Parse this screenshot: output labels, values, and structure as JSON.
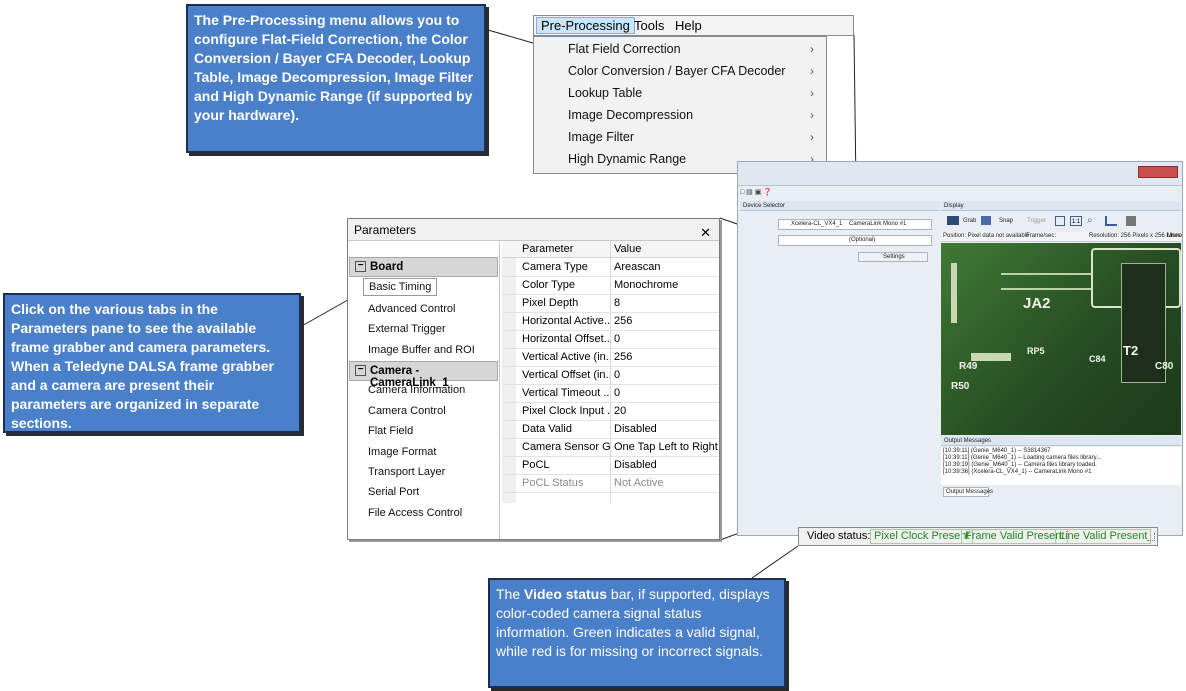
{
  "menu": {
    "bar": [
      "Pre-Processing",
      "Tools",
      "Help"
    ],
    "items": [
      "Flat Field Correction",
      "Color Conversion / Bayer CFA Decoder",
      "Lookup Table",
      "Image Decompression",
      "Image Filter",
      "High Dynamic Range"
    ]
  },
  "callouts": {
    "preprocessing": "The Pre-Processing menu allows you to configure Flat-Field Correction, the Color Conversion / Bayer CFA Decoder, Lookup Table, Image Decompression, Image Filter and High Dynamic Range (if supported by your hardware).",
    "parameters": "Click on the various tabs in the Parameters pane to see the available frame grabber and camera parameters. When a Teledyne DALSA frame grabber and a camera are present their parameters are organized in separate sections.",
    "video_bold": "Video status",
    "video_pre": "The ",
    "video_rest": " bar, if supported, displays color-coded camera signal status information. Green indicates a valid signal, while red is for missing or incorrect signals."
  },
  "app": {
    "device_selector": "Device Selector",
    "device_value": "Xcelera-CL_VX4_1",
    "config_value": "CameraLink Mono #1",
    "optional": "(Optional)",
    "settings": "Settings",
    "display": "Display",
    "toolbar": [
      "Grab",
      "Snap",
      "Trigger"
    ],
    "position_text": "Position: Pixel data not available",
    "frame_sec": "Frame/sec:",
    "resolution": "Resolution: 256 Pixels x 256 Lines",
    "mono": "Mono",
    "output_title": "Output Messages",
    "output_lines": [
      "[10:39:11] (Genie_M640_1) -- S3814367",
      "[10:39:11] (Genie_M640_1) -- Loading camera files library...",
      "[10:39:19] (Genie_M640_1) -- Camera files library loaded.",
      "[10:39:36] (Xcelera-CL_VX4_1) -- CameraLink Mono #1"
    ],
    "output_tab": "Output Messages",
    "pcb_labels": [
      "JA2",
      "R49",
      "RP5",
      "C84",
      "T2",
      "C80",
      "R50"
    ]
  },
  "parameters": {
    "title": "Parameters",
    "groups": [
      {
        "label": "Board",
        "items": [
          "Basic Timing",
          "Advanced Control",
          "External Trigger",
          "Image Buffer and ROI"
        ]
      },
      {
        "label": "Camera - CameraLink_1",
        "items": [
          "Camera Information",
          "Camera Control",
          "Flat Field",
          "Image Format",
          "Transport Layer",
          "Serial Port",
          "File Access Control"
        ]
      }
    ],
    "columns": [
      "Parameter",
      "Value"
    ],
    "rows": [
      [
        "Camera Type",
        "Areascan"
      ],
      [
        "Color Type",
        "Monochrome"
      ],
      [
        "Pixel Depth",
        "8"
      ],
      [
        "Horizontal Active...",
        "256"
      ],
      [
        "Horizontal Offset...",
        "0"
      ],
      [
        "Vertical Active (in...",
        "256"
      ],
      [
        "Vertical Offset (in...",
        "0"
      ],
      [
        "Vertical Timeout ...",
        "0"
      ],
      [
        "Pixel Clock Input ...",
        "20"
      ],
      [
        "Data Valid",
        "Disabled"
      ],
      [
        "Camera Sensor G...",
        "One Tap Left to Right"
      ],
      [
        "PoCL",
        "Disabled"
      ],
      [
        "PoCL Status",
        "Not Active"
      ]
    ]
  },
  "video_status": {
    "label": "Video status:",
    "items": [
      "Pixel Clock Present",
      "Frame Valid Present",
      "Line Valid Present"
    ]
  }
}
